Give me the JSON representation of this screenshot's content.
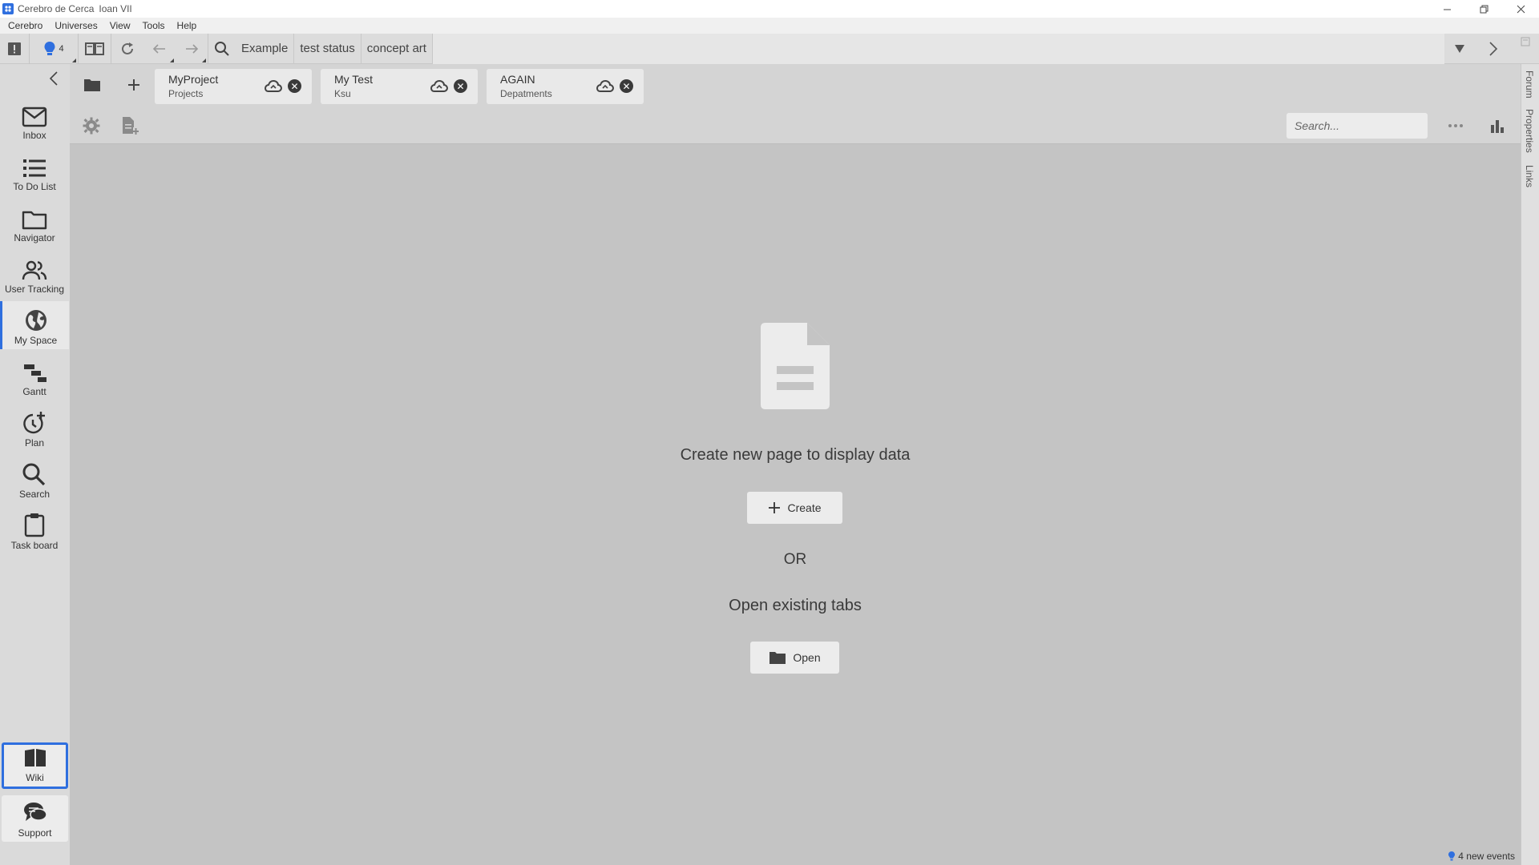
{
  "window": {
    "app_name": "Cerebro de Cerca",
    "user": "Ioan VII"
  },
  "menu": [
    "Cerebro",
    "Universes",
    "View",
    "Tools",
    "Help"
  ],
  "toolbar": {
    "notifications_count": "4",
    "queries": [
      "Example",
      "test status",
      "concept art"
    ]
  },
  "sidebar": {
    "items": [
      {
        "label": "Inbox",
        "icon": "mail-icon"
      },
      {
        "label": "To Do List",
        "icon": "list-icon"
      },
      {
        "label": "Navigator",
        "icon": "folder-icon"
      },
      {
        "label": "User Tracking",
        "icon": "users-icon"
      },
      {
        "label": "My Space",
        "icon": "globe-icon",
        "active": true
      },
      {
        "label": "Gantt",
        "icon": "gantt-icon"
      },
      {
        "label": "Plan",
        "icon": "clock-plus-icon"
      },
      {
        "label": "Search",
        "icon": "search-icon"
      },
      {
        "label": "Task board",
        "icon": "clipboard-icon"
      }
    ],
    "bottom": [
      {
        "label": "Wiki",
        "icon": "book-icon"
      },
      {
        "label": "Support",
        "icon": "chat-icon"
      }
    ]
  },
  "tabs": [
    {
      "title": "MyProject",
      "subtitle": "Projects"
    },
    {
      "title": "My Test",
      "subtitle": "Ksu"
    },
    {
      "title": "AGAIN",
      "subtitle": "Depatments"
    }
  ],
  "subtoolbar": {
    "search_placeholder": "Search..."
  },
  "right_panel": [
    "Forum",
    "Properties",
    "Links"
  ],
  "main": {
    "empty_title": "Create new page to display data",
    "create_label": "Create",
    "or_label": "OR",
    "open_title": "Open existing tabs",
    "open_label": "Open"
  },
  "status": {
    "events": "4 new events"
  },
  "colors": {
    "accent": "#2f6fdf",
    "background": "#c4c4c4"
  }
}
